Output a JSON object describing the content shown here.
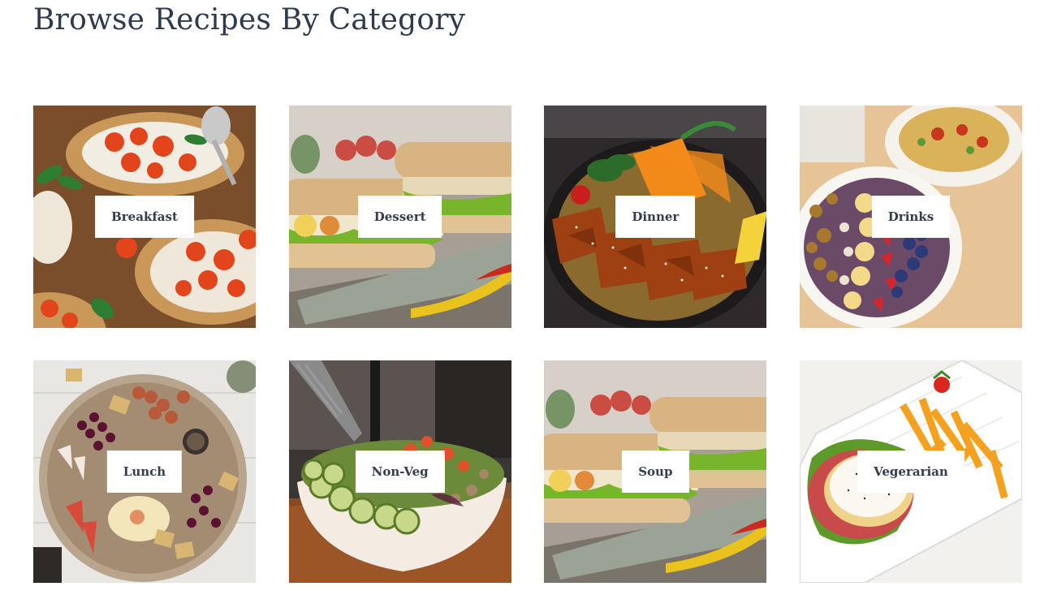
{
  "page": {
    "title": "Browse Recipes By Category"
  },
  "categories": [
    {
      "label": "Breakfast",
      "photo": "bruschetta-toast-photo"
    },
    {
      "label": "Dessert",
      "photo": "baguette-sandwich-photo"
    },
    {
      "label": "Dinner",
      "photo": "glazed-chicken-bowl-photo"
    },
    {
      "label": "Drinks",
      "photo": "smoothie-bowl-photo"
    },
    {
      "label": "Lunch",
      "photo": "charcuterie-board-photo"
    },
    {
      "label": "Non-Veg",
      "photo": "cucumber-salad-bowl-photo"
    },
    {
      "label": "Soup",
      "photo": "baguette-sandwich-photo"
    },
    {
      "label": "Vegerarian",
      "photo": "fried-egg-toast-fries-photo"
    }
  ],
  "colors": {
    "title": "#2e3a4d",
    "label_text": "#333d4d",
    "label_bg": "#ffffff"
  }
}
